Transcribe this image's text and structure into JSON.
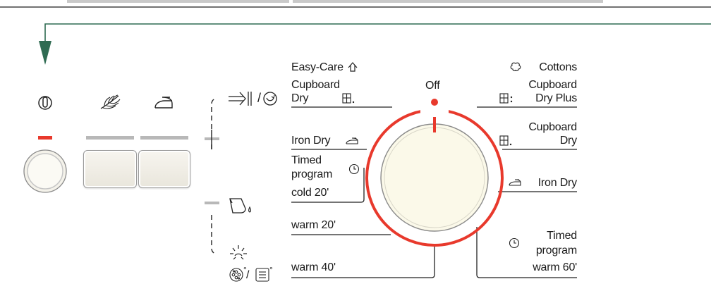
{
  "colors": {
    "arrow": "#2f6b52",
    "red": "#e8392c",
    "gray_indicator": "#b8b8b8",
    "lines": "#222222",
    "knob": "#fbf9e9"
  },
  "icons": {
    "power": "power-ring-icon",
    "wool": "wool-feather-icon",
    "iron": "iron-icon",
    "arrow_signal": "arrow-to-bar-icon",
    "cycle": "rotation-cycle-icon",
    "container": "water-container-icon",
    "sun": "sun-icon",
    "filter": "lint-filter-icon",
    "tank": "water-tank-icon",
    "cottons": "cotton-boll-icon",
    "easy_care": "easy-care-shirt-icon",
    "cupboard": "cupboard-icon",
    "clock": "clock-icon"
  },
  "dial": {
    "off_label": "Off"
  },
  "left_programs": {
    "easy_care": "Easy-Care",
    "cupboard_dry_line1": "Cupboard",
    "cupboard_dry_line2": "Dry",
    "iron_dry": "Iron Dry",
    "timed_line1": "Timed",
    "timed_line2": "program",
    "timed_line3": "cold 20'",
    "warm20": "warm 20'",
    "warm40": "warm 40'"
  },
  "right_programs": {
    "cottons": "Cottons",
    "cupboard_plus_line1": "Cupboard",
    "cupboard_plus_line2": "Dry Plus",
    "cupboard_line1": "Cupboard",
    "cupboard_line2": "Dry",
    "iron_dry": "Iron Dry",
    "timed_line1": "Timed",
    "timed_line2": "program",
    "timed_line3": "warm 60'"
  },
  "symbols": {
    "slash1": "/",
    "slash2": "/",
    "degree": "°"
  }
}
